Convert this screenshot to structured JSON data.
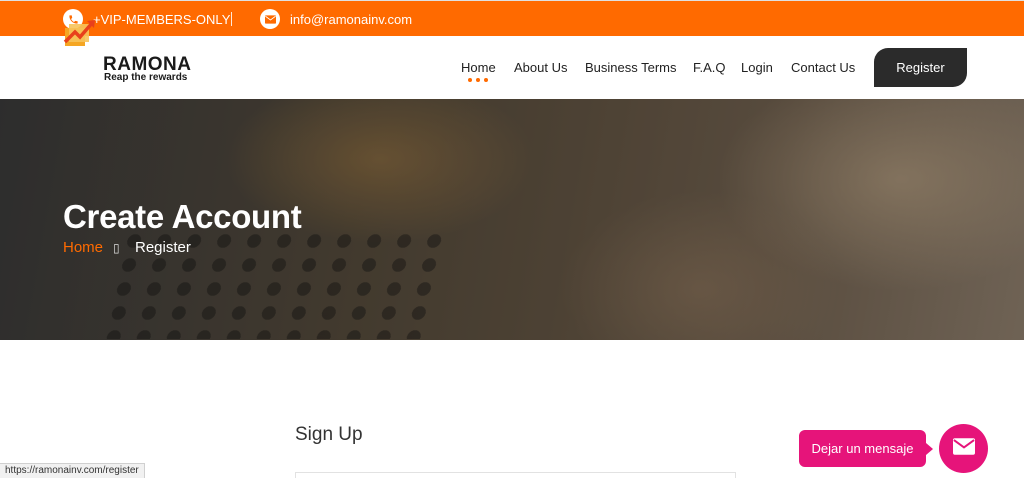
{
  "topbar": {
    "phone_text": "+VIP-MEMBERS-ONLY",
    "email_text": "info@ramonainv.com",
    "separator": "|"
  },
  "header": {
    "logo_title": "RAMONA",
    "logo_tagline": "Reap the rewards",
    "nav": [
      {
        "label": "Home",
        "active": true
      },
      {
        "label": "About Us"
      },
      {
        "label": "Business Terms"
      },
      {
        "label": "F.A.Q"
      },
      {
        "label": "Login"
      },
      {
        "label": "Contact Us"
      }
    ],
    "register_label": "Register"
  },
  "hero": {
    "title": "Create Account",
    "breadcrumb_home": "Home",
    "breadcrumb_separator": "▯",
    "breadcrumb_current": "Register"
  },
  "content": {
    "signup_title": "Sign Up"
  },
  "status_url": "https://ramonainv.com/register",
  "chat": {
    "label": "Dejar un mensaje",
    "icon": "envelope-icon"
  },
  "colors": {
    "accent": "#ff6a00",
    "dark_button": "#2b2b2b",
    "chat_pink": "#e6147a"
  }
}
